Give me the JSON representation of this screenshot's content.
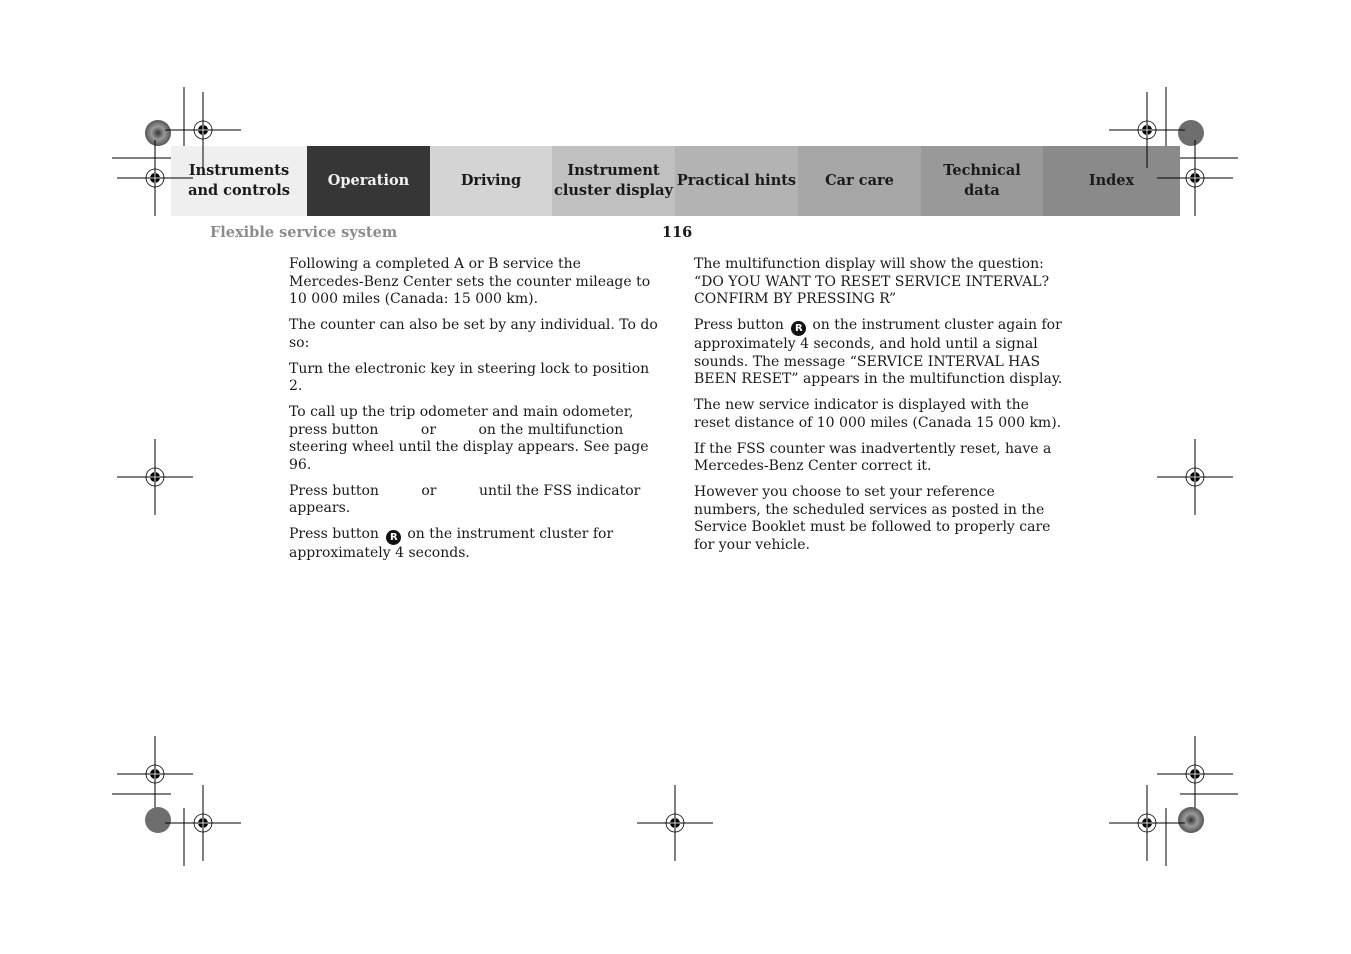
{
  "nav": {
    "tabs": [
      {
        "line1": "Instruments",
        "line2": "and controls",
        "active": false
      },
      {
        "line1": "Operation",
        "line2": "",
        "active": true
      },
      {
        "line1": "Driving",
        "line2": "",
        "active": false
      },
      {
        "line1": "Instrument",
        "line2": "cluster display",
        "active": false
      },
      {
        "line1": "Practical hints",
        "line2": "",
        "active": false
      },
      {
        "line1": "Car care",
        "line2": "",
        "active": false
      },
      {
        "line1": "Technical",
        "line2": "data",
        "active": false
      },
      {
        "line1": "Index",
        "line2": "",
        "active": false
      }
    ]
  },
  "header": {
    "section_title": "Flexible service system",
    "page_number": "116"
  },
  "left_column": {
    "p1": "Following a completed A or B service the Mercedes-Benz Center sets the counter mileage to 10 000 miles (Canada: 15 000 km).",
    "p2": "The counter can also be set by any individual. To do so:",
    "p3": "Turn the electronic key in steering lock to position 2.",
    "p4_a": "To call up the trip odometer and main odometer, press button",
    "p4_or": "or",
    "p4_b": "on the multifunction steering wheel until the display appears. See page 96.",
    "p5_a": "Press button",
    "p5_or": "or",
    "p5_b": "until the FSS indicator appears.",
    "p6_a": "Press button",
    "p6_b": "on the instrument cluster for approximately 4 seconds."
  },
  "right_column": {
    "p1": "The multifunction display will show the question: “DO YOU WANT TO RESET SERVICE INTERVAL? CONFIRM BY PRESSING R”",
    "p2_a": "Press button",
    "p2_b": "on the instrument cluster again for approximately 4 seconds, and hold until a signal sounds. The message “SERVICE INTERVAL HAS BEEN RESET” appears in the multifunction display.",
    "p3": "The new service indicator is displayed with the reset distance of 10 000 miles (Canada 15 000 km).",
    "p4": "If the FSS counter was inadvertently reset, have a Mercedes-Benz Center correct it.",
    "p5": "However you choose to set your reference numbers, the scheduled services as posted in the Service Booklet must be followed to properly care for your vehicle."
  },
  "icons": {
    "reset_button_glyph": "R"
  }
}
